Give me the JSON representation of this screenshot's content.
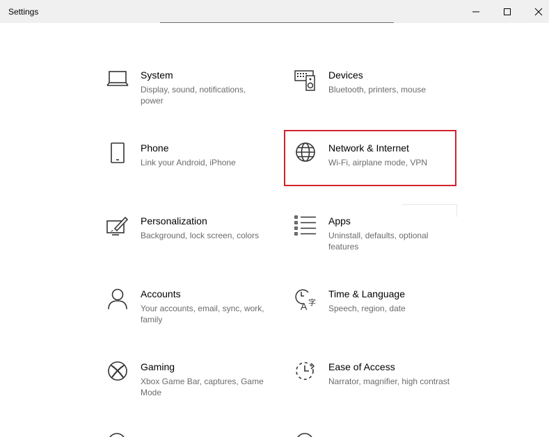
{
  "window": {
    "title": "Settings"
  },
  "tiles": [
    {
      "label": "System",
      "desc": "Display, sound, notifications, power",
      "icon": "laptop-icon"
    },
    {
      "label": "Devices",
      "desc": "Bluetooth, printers, mouse",
      "icon": "keyboard-speaker-icon"
    },
    {
      "label": "Phone",
      "desc": "Link your Android, iPhone",
      "icon": "phone-icon"
    },
    {
      "label": "Network & Internet",
      "desc": "Wi-Fi, airplane mode, VPN",
      "icon": "globe-icon"
    },
    {
      "label": "Personalization",
      "desc": "Background, lock screen, colors",
      "icon": "paint-monitor-icon"
    },
    {
      "label": "Apps",
      "desc": "Uninstall, defaults, optional features",
      "icon": "apps-list-icon"
    },
    {
      "label": "Accounts",
      "desc": "Your accounts, email, sync, work, family",
      "icon": "person-icon"
    },
    {
      "label": "Time & Language",
      "desc": "Speech, region, date",
      "icon": "time-language-icon"
    },
    {
      "label": "Gaming",
      "desc": "Xbox Game Bar, captures, Game Mode",
      "icon": "xbox-icon"
    },
    {
      "label": "Ease of Access",
      "desc": "Narrator, magnifier, high contrast",
      "icon": "ease-of-access-icon"
    }
  ],
  "colors": {
    "highlight": "#d3212c",
    "description": "#6b6b6b"
  }
}
